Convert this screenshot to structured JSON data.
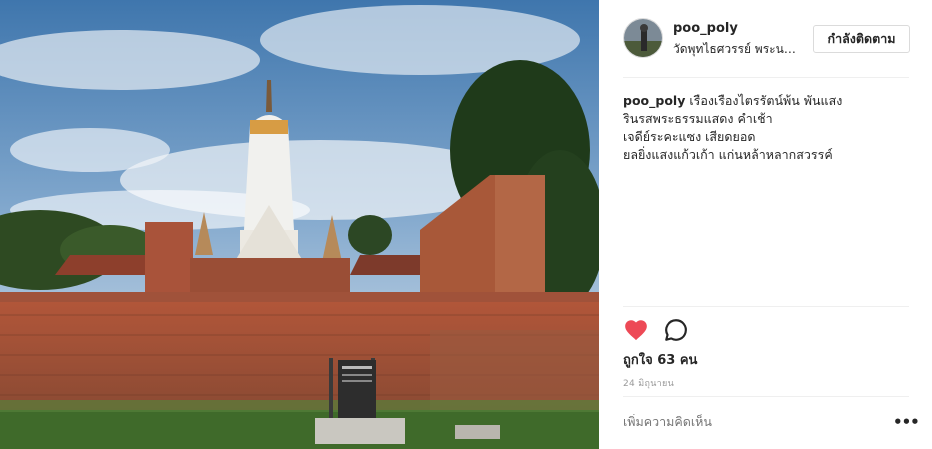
{
  "post": {
    "username": "poo_poly",
    "location": "วัดพุทไธศวรรย์ พระนครศรีอยุธยา",
    "follow_label": "กำลังติดตาม",
    "caption": {
      "user": "poo_poly",
      "lines": [
        "เรืองเรืองไตรรัตน์พ้น พันแสง",
        "รินรสพระธรรมแสดง คำเช้า",
        "เจดีย์ระคะแซง เสียดยอด",
        "ยลยิ่งแสงแก้วเก้า แก่นหล้าหลากสวรรค์"
      ]
    },
    "likes_text": "ถูกใจ 63 คน",
    "date_text": "24 มิถุนายน",
    "comment_placeholder": "เพิ่มความคิดเห็น",
    "more_label": "•••"
  },
  "icons": {
    "heart": "heart-icon",
    "comment": "comment-icon",
    "more": "more-options-icon"
  },
  "colors": {
    "heart": "#ed4956",
    "text": "#262626",
    "muted": "#999999",
    "border": "#dbdbdb"
  }
}
